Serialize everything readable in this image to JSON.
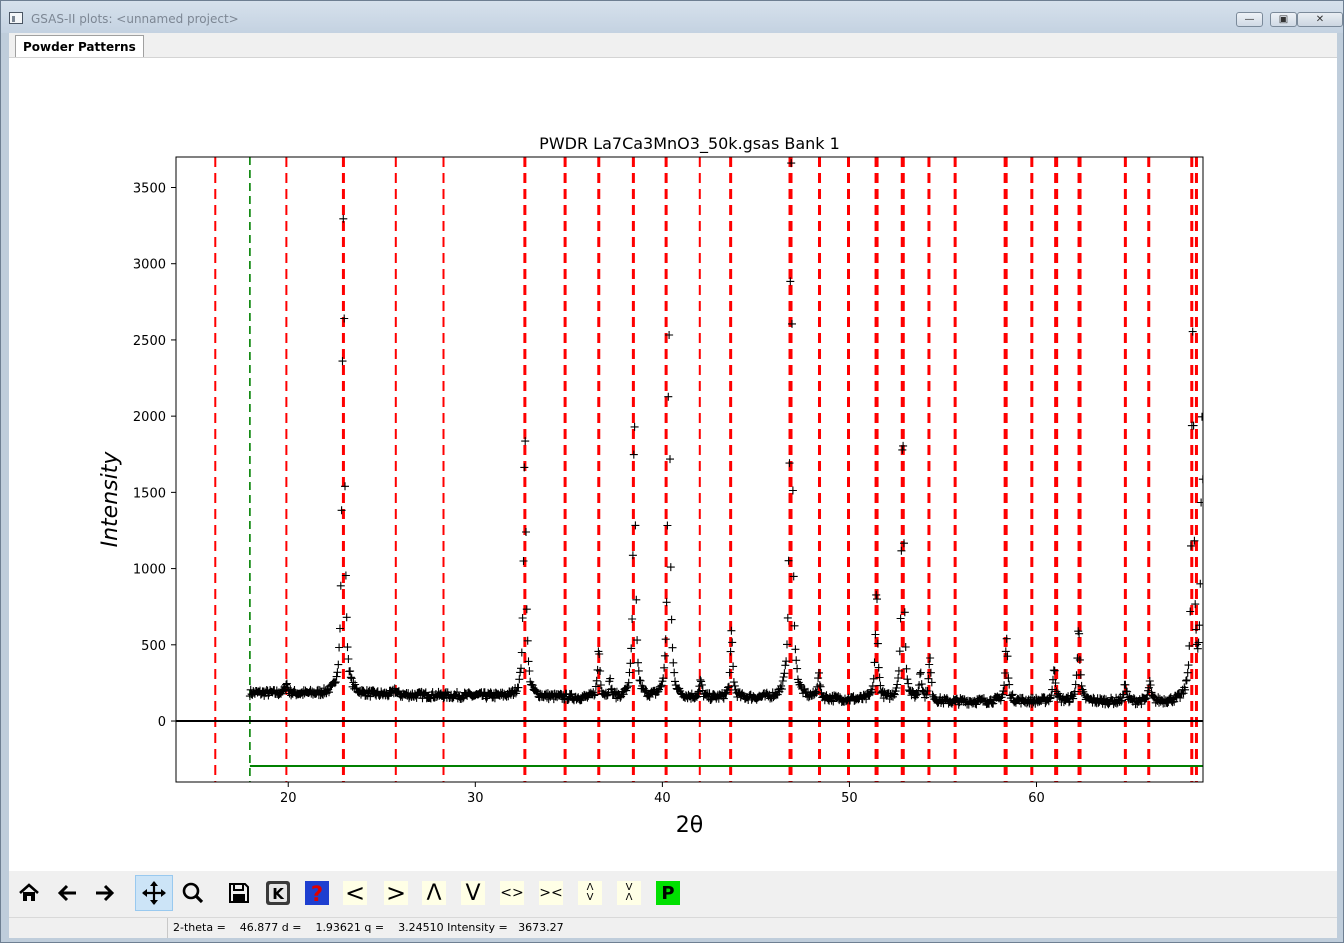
{
  "window": {
    "title": "GSAS-II plots: <unnamed project>",
    "controls": {
      "minimize": "minimize-icon",
      "maximize": "maximize-icon",
      "close": "close-icon"
    }
  },
  "tabs": [
    {
      "label": "Powder Patterns",
      "selected": true
    }
  ],
  "chart_data": {
    "type": "scatter",
    "title": "PWDR La7Ca3MnO3_50k.gsas Bank 1",
    "xlabel": "2θ",
    "ylabel": "Intensity",
    "xlim": [
      14.0,
      68.9
    ],
    "ylim": [
      -400,
      3700
    ],
    "xticks": [
      20,
      30,
      40,
      50,
      60
    ],
    "yticks": [
      0,
      500,
      1000,
      1500,
      2000,
      2500,
      3000,
      3500
    ],
    "marker": "+",
    "colors": {
      "observed": "#000000",
      "reflections": "#ff0000",
      "limit": "#008000",
      "zero_line": "#000000"
    },
    "background_levels": [
      [
        18.0,
        185
      ],
      [
        22.5,
        175
      ],
      [
        26.0,
        170
      ],
      [
        30.0,
        165
      ],
      [
        33.5,
        158
      ],
      [
        36.0,
        150
      ],
      [
        40.0,
        150
      ],
      [
        46.0,
        150
      ],
      [
        50.0,
        140
      ],
      [
        55.0,
        125
      ],
      [
        58.0,
        130
      ],
      [
        62.0,
        130
      ],
      [
        66.0,
        125
      ],
      [
        68.9,
        130
      ]
    ],
    "peaks": [
      {
        "x": 19.9,
        "height": 250
      },
      {
        "x": 22.95,
        "height": 3320
      },
      {
        "x": 25.7,
        "height": 205
      },
      {
        "x": 32.65,
        "height": 1920
      },
      {
        "x": 36.6,
        "height": 470
      },
      {
        "x": 37.2,
        "height": 250
      },
      {
        "x": 38.5,
        "height": 1980
      },
      {
        "x": 40.35,
        "height": 2550
      },
      {
        "x": 42.05,
        "height": 260
      },
      {
        "x": 43.7,
        "height": 580
      },
      {
        "x": 46.88,
        "height": 3673
      },
      {
        "x": 48.35,
        "height": 300
      },
      {
        "x": 51.45,
        "height": 860
      },
      {
        "x": 52.85,
        "height": 1940
      },
      {
        "x": 53.8,
        "height": 320
      },
      {
        "x": 54.3,
        "height": 400
      },
      {
        "x": 58.4,
        "height": 540
      },
      {
        "x": 60.95,
        "height": 360
      },
      {
        "x": 62.25,
        "height": 640
      },
      {
        "x": 64.75,
        "height": 245
      },
      {
        "x": 66.05,
        "height": 250
      },
      {
        "x": 68.35,
        "height": 2520
      },
      {
        "x": 68.85,
        "height": 1950
      }
    ],
    "reflections": [
      16.1,
      19.9,
      22.95,
      25.75,
      28.3,
      32.65,
      34.8,
      36.6,
      38.45,
      40.2,
      42.0,
      43.65,
      46.85,
      48.4,
      49.95,
      51.45,
      52.85,
      54.25,
      55.65,
      58.35,
      59.75,
      61.05,
      62.3,
      64.75,
      66.0,
      68.3,
      68.55
    ],
    "reflection_thickness": [
      2,
      2,
      3,
      2,
      2,
      3,
      3,
      3,
      3,
      3,
      2,
      3,
      4,
      3,
      3,
      4,
      4,
      3,
      3,
      4,
      3,
      4,
      4,
      3,
      3,
      3,
      3
    ],
    "excluded_limit_x": 17.95,
    "zero_line_y": 0,
    "limit_line_y": -295
  },
  "toolbar": {
    "buttons": [
      {
        "name": "home-button",
        "icon": "home-icon"
      },
      {
        "name": "back-button",
        "icon": "arrow-left-icon"
      },
      {
        "name": "forward-button",
        "icon": "arrow-right-icon"
      },
      {
        "name": "pan-button",
        "icon": "move-icon",
        "active": true
      },
      {
        "name": "zoom-button",
        "icon": "magnifier-icon"
      },
      {
        "name": "save-button",
        "icon": "floppy-icon"
      },
      {
        "name": "key-press-button",
        "icon": "key-icon"
      },
      {
        "name": "help-button",
        "icon": "question-icon"
      },
      {
        "name": "shift-left-button",
        "glyph": "<"
      },
      {
        "name": "shift-right-button",
        "glyph": ">"
      },
      {
        "name": "shift-up-button",
        "glyph": "Λ"
      },
      {
        "name": "shift-down-button",
        "glyph": "V"
      },
      {
        "name": "expand-x-button",
        "glyph": "<>"
      },
      {
        "name": "shrink-x-button",
        "glyph": "><"
      },
      {
        "name": "expand-y-button",
        "glyph": "Λ\nV"
      },
      {
        "name": "shrink-y-button",
        "glyph": "V\nΛ"
      },
      {
        "name": "publish-button",
        "glyph": "P"
      }
    ]
  },
  "status": {
    "text": "2-theta =    46.877 d =    1.93621 q =    3.24510 Intensity =   3673.27"
  }
}
